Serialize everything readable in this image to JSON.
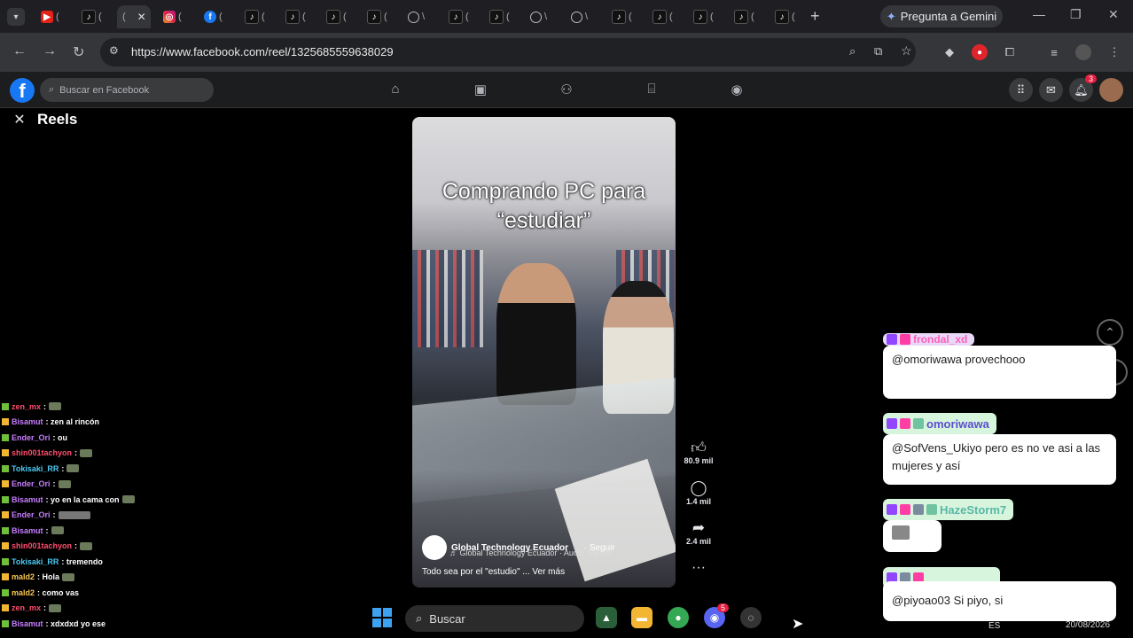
{
  "browser": {
    "tabs": [
      {
        "icon": "youtube-icon",
        "label": "("
      },
      {
        "icon": "tiktok-icon",
        "label": "("
      },
      {
        "icon": "close-icon",
        "label": "(",
        "active": true
      },
      {
        "icon": "instagram-icon",
        "label": "("
      },
      {
        "icon": "facebook-icon",
        "label": "("
      },
      {
        "icon": "tiktok-icon",
        "label": "("
      },
      {
        "icon": "tiktok-icon",
        "label": "("
      },
      {
        "icon": "tiktok-icon",
        "label": "("
      },
      {
        "icon": "tiktok-icon",
        "label": "("
      },
      {
        "icon": "globe-icon",
        "label": "\\"
      },
      {
        "icon": "tiktok-icon",
        "label": "("
      },
      {
        "icon": "tiktok-icon",
        "label": "("
      },
      {
        "icon": "globe-icon",
        "label": "\\"
      },
      {
        "icon": "globe-icon",
        "label": "\\"
      },
      {
        "icon": "tiktok-icon",
        "label": "("
      },
      {
        "icon": "tiktok-icon",
        "label": "("
      },
      {
        "icon": "tiktok-icon",
        "label": "("
      },
      {
        "icon": "tiktok-icon",
        "label": "("
      },
      {
        "icon": "tiktok-icon",
        "label": "("
      }
    ],
    "gemini_label": "Pregunta a Gemini",
    "url": "https://www.facebook.com/reel/1325685559638029"
  },
  "facebook": {
    "search_placeholder": "Buscar en Facebook",
    "notifications_count": "3",
    "reels_title": "Reels"
  },
  "reel": {
    "caption_line1": "Comprando PC para",
    "caption_line2": "“estudiar”",
    "author": "Global Technology Ecuador",
    "follow": "· Seguir",
    "audio": "♬ Global Technology Ecuador · Audio original",
    "description": "Todo sea por el \"estudio\" ... Ver más",
    "likes": "80.9 mil",
    "comments": "1.4 mil",
    "shares": "2.4 mil"
  },
  "chat_left": [
    {
      "user": "zen_mx",
      "color": "#ff4d6d",
      "text": ":"
    },
    {
      "user": "Bisamut",
      "color": "#c77dff",
      "text": ": zen al rincón"
    },
    {
      "user": "Ender_Ori",
      "color": "#c77dff",
      "text": ": ou"
    },
    {
      "user": "shin001tachyon",
      "color": "#ff4d6d",
      "text": ":"
    },
    {
      "user": "Tokisaki_RR",
      "color": "#4cc9f0",
      "text": ":"
    },
    {
      "user": "Ender_Ori",
      "color": "#c77dff",
      "text": ":"
    },
    {
      "user": "Bisamut",
      "color": "#c77dff",
      "text": ": yo en la cama con"
    },
    {
      "user": "Ender_Ori",
      "color": "#c77dff",
      "text": ":"
    },
    {
      "user": "Bisamut",
      "color": "#c77dff",
      "text": ":"
    },
    {
      "user": "shin001tachyon",
      "color": "#ff4d6d",
      "text": ":"
    },
    {
      "user": "Tokisaki_RR",
      "color": "#4cc9f0",
      "text": ": tremendo"
    },
    {
      "user": "mald2",
      "color": "#f9c74f",
      "text": ": Hola"
    },
    {
      "user": "mald2",
      "color": "#f9c74f",
      "text": ": como vas"
    },
    {
      "user": "zen_mx",
      "color": "#ff4d6d",
      "text": ":"
    },
    {
      "user": "Bisamut",
      "color": "#c77dff",
      "text": ": xdxdxd yo ese"
    }
  ],
  "chat_right": {
    "msg1_user": "frondal_xd",
    "msg1_text": "@omoriwawa provechooo",
    "msg2_user": "omoriwawa",
    "msg2_text": "@SofVens_Ukiyo pero es no ve asi a las mujeres y así",
    "msg3_user": "HazeStorm7",
    "msg4_text": "@piyoao03 Si piyo, si"
  },
  "taskbar": {
    "search_label": "Buscar",
    "discord_badge": "5",
    "lang": "ES",
    "date": "20/08/2026"
  },
  "colors": {
    "facebook_blue": "#1877f2",
    "chat_green": "#d7f5dc"
  }
}
